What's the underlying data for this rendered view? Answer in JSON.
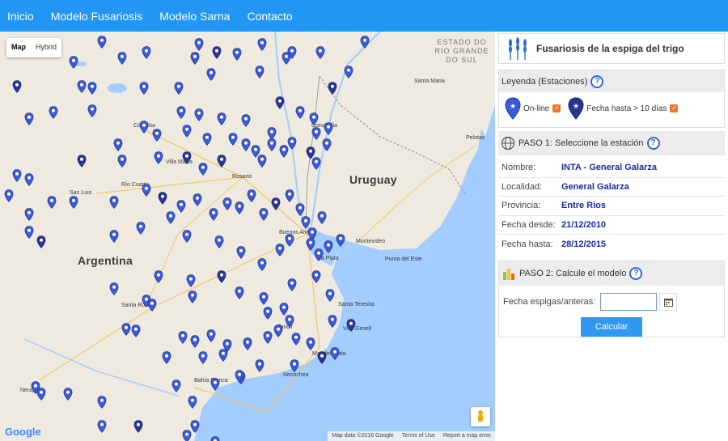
{
  "nav": {
    "items": [
      "Inicio",
      "Modelo Fusariosis",
      "Modelo Sarna",
      "Contacto"
    ]
  },
  "map": {
    "type_controls": [
      "Map",
      "Hybrid"
    ],
    "labels": {
      "argentina": "Argentina",
      "uruguay": "Uruguay",
      "rio_grande_do_sul": "ESTADO DO RIO GRANDE DO SUL",
      "montevideo": "Montevideo",
      "buenos_aires": "Buenos Aires",
      "la_plata": "La Plata",
      "rosario": "Rosario",
      "cordoba": "Córdoba",
      "concordia": "Concordia",
      "pelotas": "Pelotas",
      "santa_maria": "Santa Maria",
      "mar_del_plata": "Mar del Plata",
      "bahia_blanca": "Bahía Blanca",
      "santa_rosa": "Santa Rosa",
      "rio_cuarto": "Río Cuarto",
      "villa_maria": "Villa María",
      "san_luis": "San Luis",
      "tandil": "Tandil",
      "necochea": "Necochea",
      "neuquen": "Neuquén",
      "punta_del_este": "Punta del Este",
      "santa_teresita": "Santa Teresita",
      "villa_gesell": "Villa Gesell"
    },
    "footer": [
      "Map data ©2016 Google",
      "Terms of Use",
      "Report a map error"
    ],
    "google_logo": "Google",
    "colors": {
      "online_pin": "#3b5bdb",
      "old_pin": "#283593",
      "water": "#a3ccff",
      "land": "#efeadf"
    }
  },
  "panel": {
    "title": "Fusariosis de la espiga del trigo",
    "legend": {
      "heading": "Leyenda (Estaciones)",
      "online_label": "On-line",
      "old_label": "Fecha hasta > 10 días"
    },
    "paso1": {
      "heading": "PASO 1: Seleccione la estación",
      "rows": [
        {
          "key": "Nombre:",
          "value": "INTA - General Galarza"
        },
        {
          "key": "Localidad:",
          "value": "General Galarza"
        },
        {
          "key": "Provincia:",
          "value": "Entre Rios"
        },
        {
          "key": "Fecha desde:",
          "value": "21/12/2010"
        },
        {
          "key": "Fecha hasta:",
          "value": "28/12/2015"
        }
      ]
    },
    "paso2": {
      "heading": "PASO 2: Calcule el modelo",
      "fecha_label": "Fecha espigas/anteras:",
      "fecha_value": "",
      "button": "Calcular"
    }
  }
}
